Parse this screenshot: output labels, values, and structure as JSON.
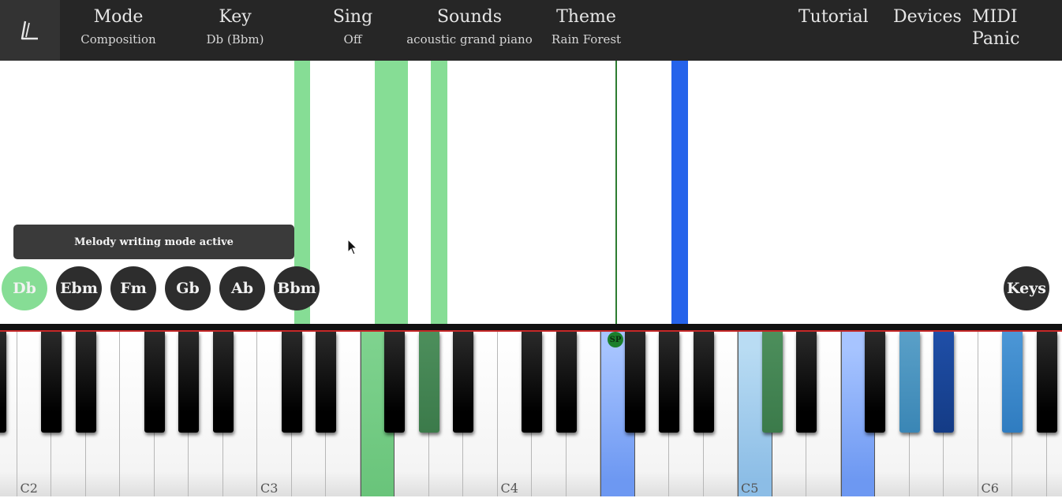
{
  "topbar": {
    "logo_name": "app-logo",
    "menus": [
      {
        "id": "mode",
        "title": "Mode",
        "value": "Composition"
      },
      {
        "id": "key",
        "title": "Key",
        "value": "Db (Bbm)"
      },
      {
        "id": "sing",
        "title": "Sing",
        "value": "Off"
      },
      {
        "id": "sounds",
        "title": "Sounds",
        "value": "acoustic grand piano"
      },
      {
        "id": "theme",
        "title": "Theme",
        "value": "Rain Forest"
      }
    ],
    "right_menus": [
      "Tutorial",
      "Devices",
      "MIDI Panic"
    ]
  },
  "toast": "Melody writing mode active",
  "chords": [
    {
      "label": "Db",
      "active": true
    },
    {
      "label": "Ebm",
      "active": false
    },
    {
      "label": "Fm",
      "active": false
    },
    {
      "label": "Gb",
      "active": false
    },
    {
      "label": "Ab",
      "active": false
    },
    {
      "label": "Bbm",
      "active": false
    }
  ],
  "keys_button": "Keys",
  "playhead_marker": "SP",
  "octave_labels": [
    "C2",
    "C3",
    "C4",
    "C5",
    "C6"
  ],
  "colors": {
    "topbar": "#262626",
    "chord_active": "#86dd95",
    "note_green": "#86dd95",
    "note_blue": "#2563eb",
    "playhead": "#2e7d32",
    "red_line": "#c62828"
  },
  "icons": {
    "cursor": "mouse-pointer-icon"
  }
}
